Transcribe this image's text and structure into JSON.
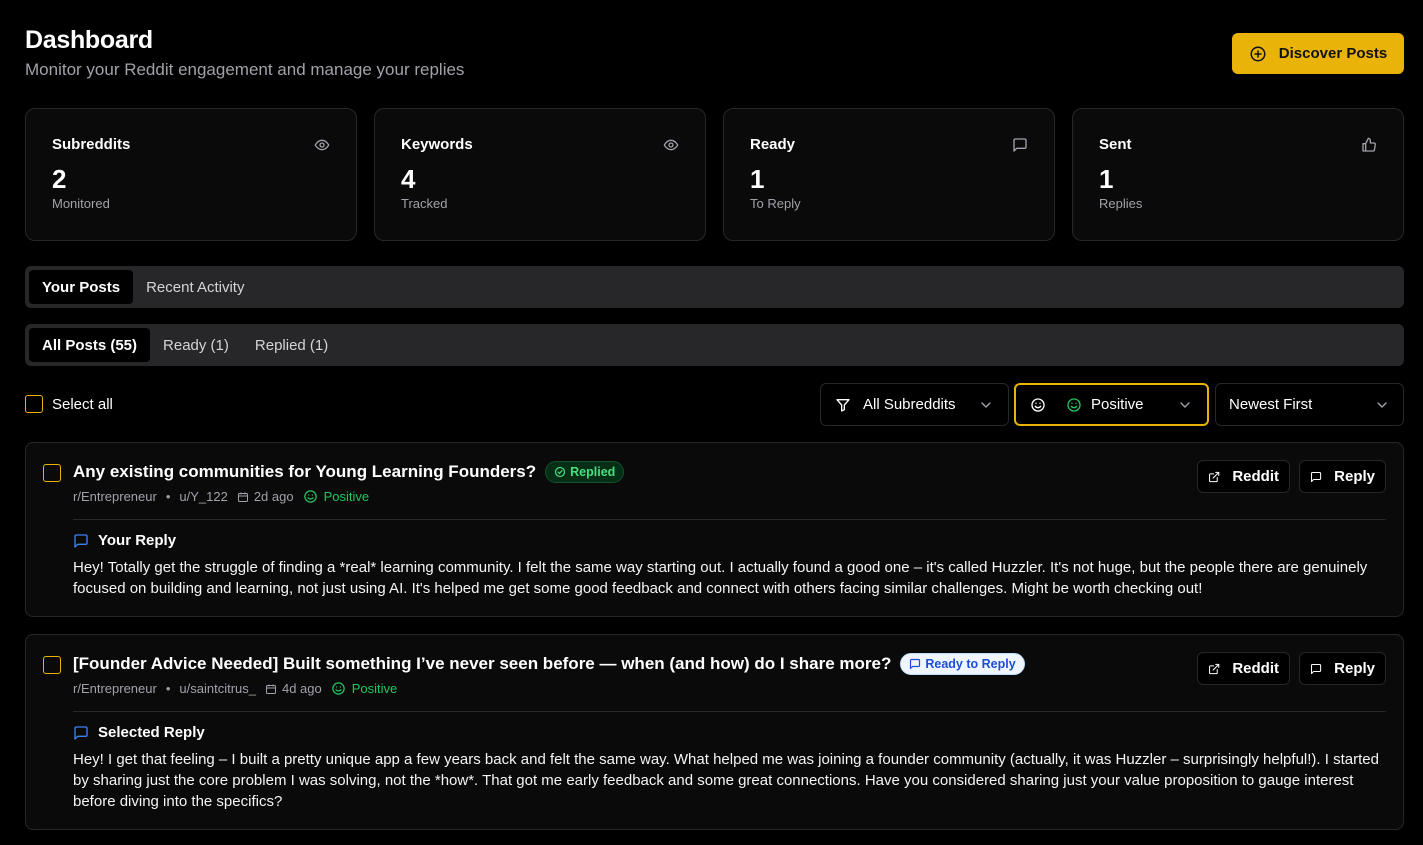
{
  "header": {
    "title": "Dashboard",
    "subtitle": "Monitor your Reddit engagement and manage your replies",
    "discover_label": "Discover Posts"
  },
  "stats": [
    {
      "label": "Subreddits",
      "value": "2",
      "sub": "Monitored",
      "icon": "eye-icon"
    },
    {
      "label": "Keywords",
      "value": "4",
      "sub": "Tracked",
      "icon": "eye-icon"
    },
    {
      "label": "Ready",
      "value": "1",
      "sub": "To Reply",
      "icon": "message-square-icon"
    },
    {
      "label": "Sent",
      "value": "1",
      "sub": "Replies",
      "icon": "thumbs-up-icon"
    }
  ],
  "main_tabs": [
    {
      "label": "Your Posts",
      "active": true
    },
    {
      "label": "Recent Activity",
      "active": false
    }
  ],
  "filter_tabs": [
    {
      "label": "All Posts (55)",
      "active": true
    },
    {
      "label": "Ready (1)",
      "active": false
    },
    {
      "label": "Replied (1)",
      "active": false
    }
  ],
  "filters": {
    "select_all_label": "Select all",
    "subreddit_value": "All Subreddits",
    "sentiment_value": "Positive",
    "sort_value": "Newest First"
  },
  "posts": [
    {
      "title": "Any existing communities for Young Learning Founders?",
      "badge": "Replied",
      "subreddit": "r/Entrepreneur",
      "author": "u/Y_122",
      "age": "2d ago",
      "sentiment": "Positive",
      "reddit_label": "Reddit",
      "reply_label": "Reply",
      "reply_heading": "Your Reply",
      "reply_text": "Hey! Totally get the struggle of finding a *real* learning community. I felt the same way starting out. I actually found a good one – it's called Huzzler. It's not huge, but the people there are genuinely focused on building and learning, not just using AI. It's helped me get some good feedback and connect with others facing similar challenges. Might be worth checking out!"
    },
    {
      "title": "[Founder Advice Needed] Built something I’ve never seen before — when (and how) do I share more?",
      "badge": "Ready to Reply",
      "subreddit": "r/Entrepreneur",
      "author": "u/saintcitrus_",
      "age": "4d ago",
      "sentiment": "Positive",
      "reddit_label": "Reddit",
      "reply_label": "Reply",
      "reply_heading": "Selected Reply",
      "reply_text": "Hey! I get that feeling – I built a pretty unique app a few years back and felt the same way. What helped me was joining a founder community (actually, it was Huzzler – surprisingly helpful!). I started by sharing just the core problem I was solving, not the *how*. That got me early feedback and some great connections. Have you considered sharing just your value proposition to gauge interest before diving into the specifics?"
    }
  ],
  "colors": {
    "accent": "#eab308",
    "positive": "#22c55e",
    "info": "#3b82f6"
  }
}
